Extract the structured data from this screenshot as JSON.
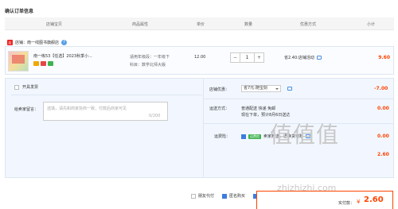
{
  "page_title": "确认订单信息",
  "header": {
    "store": "店铺宝贝",
    "attr": "商品属性",
    "price": "单价",
    "qty": "数量",
    "promo": "优惠方式",
    "subtotal": "小计"
  },
  "store": {
    "prefix": "店铺：",
    "name": "南一线图书旗舰店"
  },
  "item": {
    "name": "南一练53【任选】2023秋季小...",
    "attr_grade": "适用年级段：一年级下",
    "attr_subject": "科目：数学北师大版",
    "price": "12.00",
    "qty": "1",
    "qty_minus": "−",
    "qty_plus": "+",
    "promo": "省2.40:店铺活动",
    "subtotal": "9.60"
  },
  "invoice": {
    "label": "开具发票"
  },
  "message": {
    "label": "给卖家留言：",
    "placeholder": "选填，请先和商家协商一致，付款后商家可见",
    "count": "0/200"
  },
  "shop_discount": {
    "label": "店铺优惠：",
    "selected": "省7元:随宝剑",
    "value": "-7.00"
  },
  "shipping": {
    "label": "运送方式：",
    "line1": "普通配送 快递 免邮",
    "line2": "现在下单，预计8月6日送达",
    "value": "0.00"
  },
  "insurance": {
    "label": "运费险：",
    "badge": "运费险",
    "text": "卖家赠送，退换货可赔",
    "value": "0.00"
  },
  "subtotal_row": {
    "value": "2.60"
  },
  "bottom": {
    "anonymous_pay": "朋友代付",
    "anonymous_buy": "匿名购买"
  },
  "total": {
    "label": "实付款：",
    "currency": "¥",
    "value": "2.60"
  },
  "watermark": {
    "logo": "值值值",
    "url": "zhizhizhi.com"
  }
}
